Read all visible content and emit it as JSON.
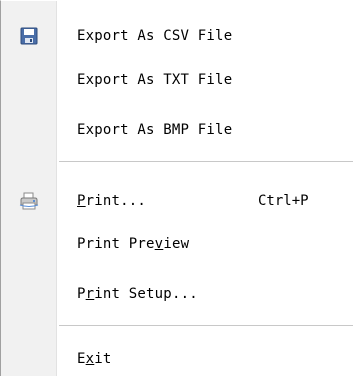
{
  "menu": {
    "items": [
      {
        "label": "Export As CSV File",
        "icon": "floppy-disk-save-icon"
      },
      {
        "label": "Export As TXT File"
      },
      {
        "label": "Export As BMP File"
      },
      {
        "label_pre": "",
        "mnemonic": "P",
        "label_post": "rint...",
        "shortcut": "Ctrl+P",
        "icon": "printer-icon"
      },
      {
        "label_pre": "Print Pre",
        "mnemonic": "v",
        "label_post": "iew"
      },
      {
        "label_pre": "P",
        "mnemonic": "r",
        "label_post": "int Setup..."
      },
      {
        "label_pre": "E",
        "mnemonic": "x",
        "label_post": "it"
      }
    ]
  },
  "colors": {
    "gutter": "#f1f1f1",
    "separator": "#c8c8c8",
    "save_icon": "#4a6ea8"
  }
}
